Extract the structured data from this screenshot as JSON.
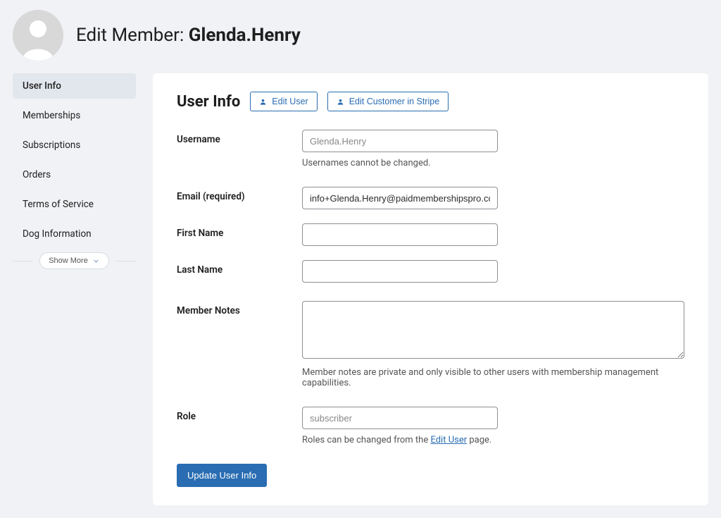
{
  "header": {
    "title_prefix": "Edit Member: ",
    "username": "Glenda.Henry"
  },
  "sidebar": {
    "items": [
      {
        "label": "User Info",
        "active": true
      },
      {
        "label": "Memberships",
        "active": false
      },
      {
        "label": "Subscriptions",
        "active": false
      },
      {
        "label": "Orders",
        "active": false
      },
      {
        "label": "Terms of Service",
        "active": false
      },
      {
        "label": "Dog Information",
        "active": false
      }
    ],
    "show_more_label": "Show More"
  },
  "section": {
    "title": "User Info",
    "edit_user_label": "Edit User",
    "edit_stripe_label": "Edit Customer in Stripe"
  },
  "form": {
    "username": {
      "label": "Username",
      "value": "Glenda.Henry",
      "helper": "Usernames cannot be changed."
    },
    "email": {
      "label": "Email (required)",
      "value": "info+Glenda.Henry@paidmembershipspro.com"
    },
    "first_name": {
      "label": "First Name",
      "value": ""
    },
    "last_name": {
      "label": "Last Name",
      "value": ""
    },
    "member_notes": {
      "label": "Member Notes",
      "value": "",
      "helper": "Member notes are private and only visible to other users with membership management capabilities."
    },
    "role": {
      "label": "Role",
      "value": "subscriber",
      "helper_before": "Roles can be changed from the ",
      "helper_link": "Edit User",
      "helper_after": " page."
    },
    "submit_label": "Update User Info"
  }
}
